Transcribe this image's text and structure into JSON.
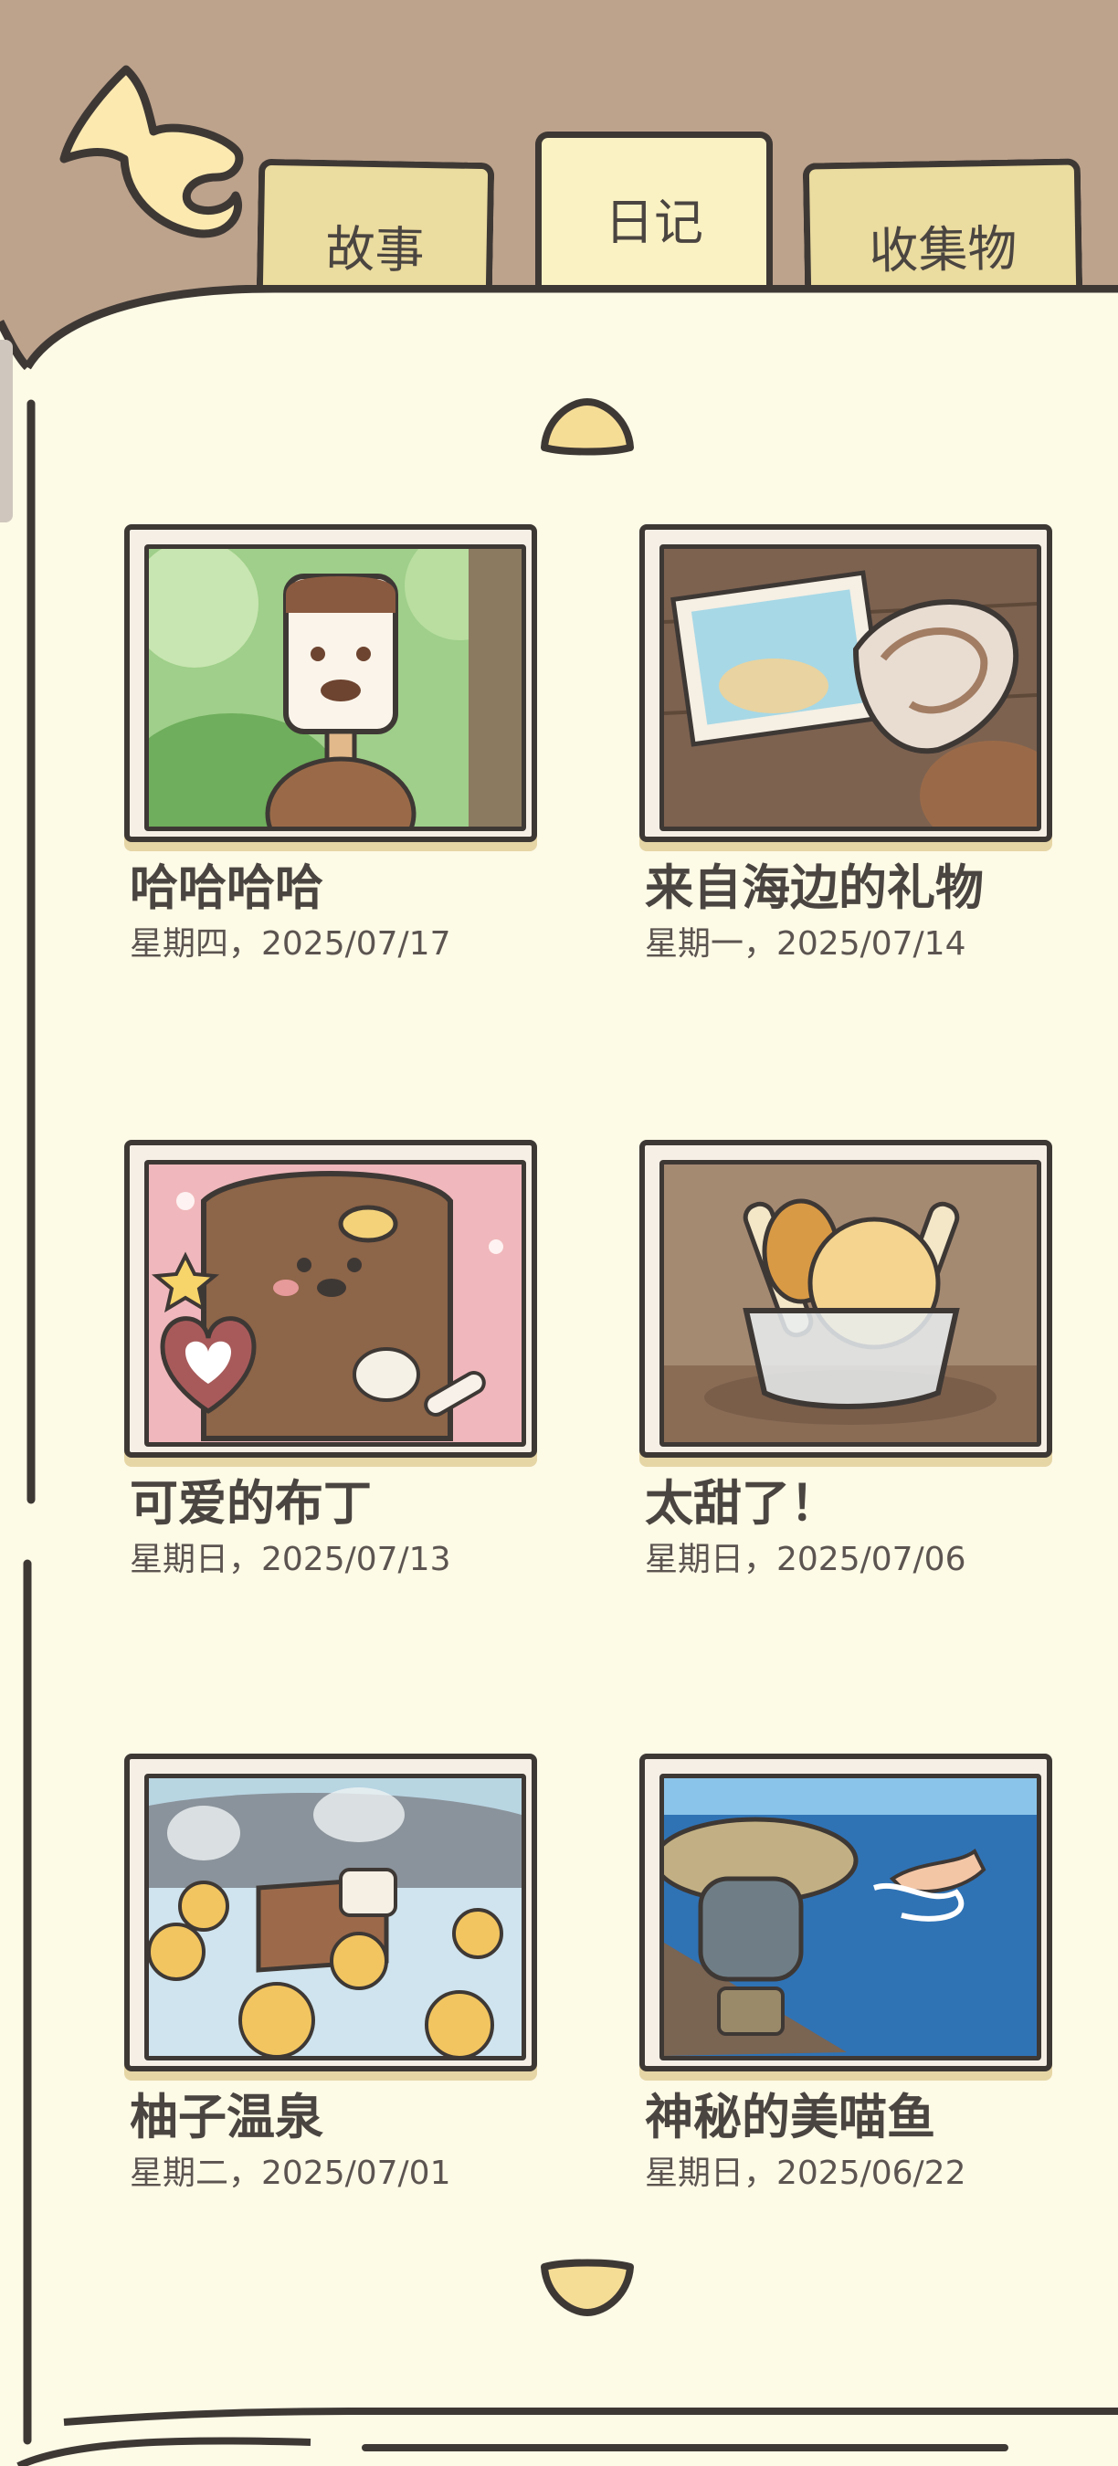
{
  "tabs": [
    {
      "label": "故事",
      "active": false
    },
    {
      "label": "日记",
      "active": true
    },
    {
      "label": "收集物",
      "active": false
    }
  ],
  "colors": {
    "background": "#bda38c",
    "page": "#fdfae6",
    "tab_inactive": "#ebdc9f",
    "tab_active": "#fbf2c4",
    "outline": "#3e3835",
    "arrow": "#fbe9b0"
  },
  "icons": {
    "back": "back-arrow-icon",
    "scroll_up": "scroll-up-arrow-icon",
    "scroll_down": "scroll-down-arrow-icon"
  },
  "diary_entries": [
    {
      "title": "哈哈哈哈",
      "date": "星期四，2025/07/17"
    },
    {
      "title": "来自海边的礼物",
      "date": "星期一，2025/07/14"
    },
    {
      "title": "可爱的布丁",
      "date": "星期日，2025/07/13"
    },
    {
      "title": "太甜了！",
      "date": "星期日，2025/07/06"
    },
    {
      "title": "柚子温泉",
      "date": "星期二，2025/07/01"
    },
    {
      "title": "神秘的美喵鱼",
      "date": "星期日，2025/06/22"
    }
  ]
}
